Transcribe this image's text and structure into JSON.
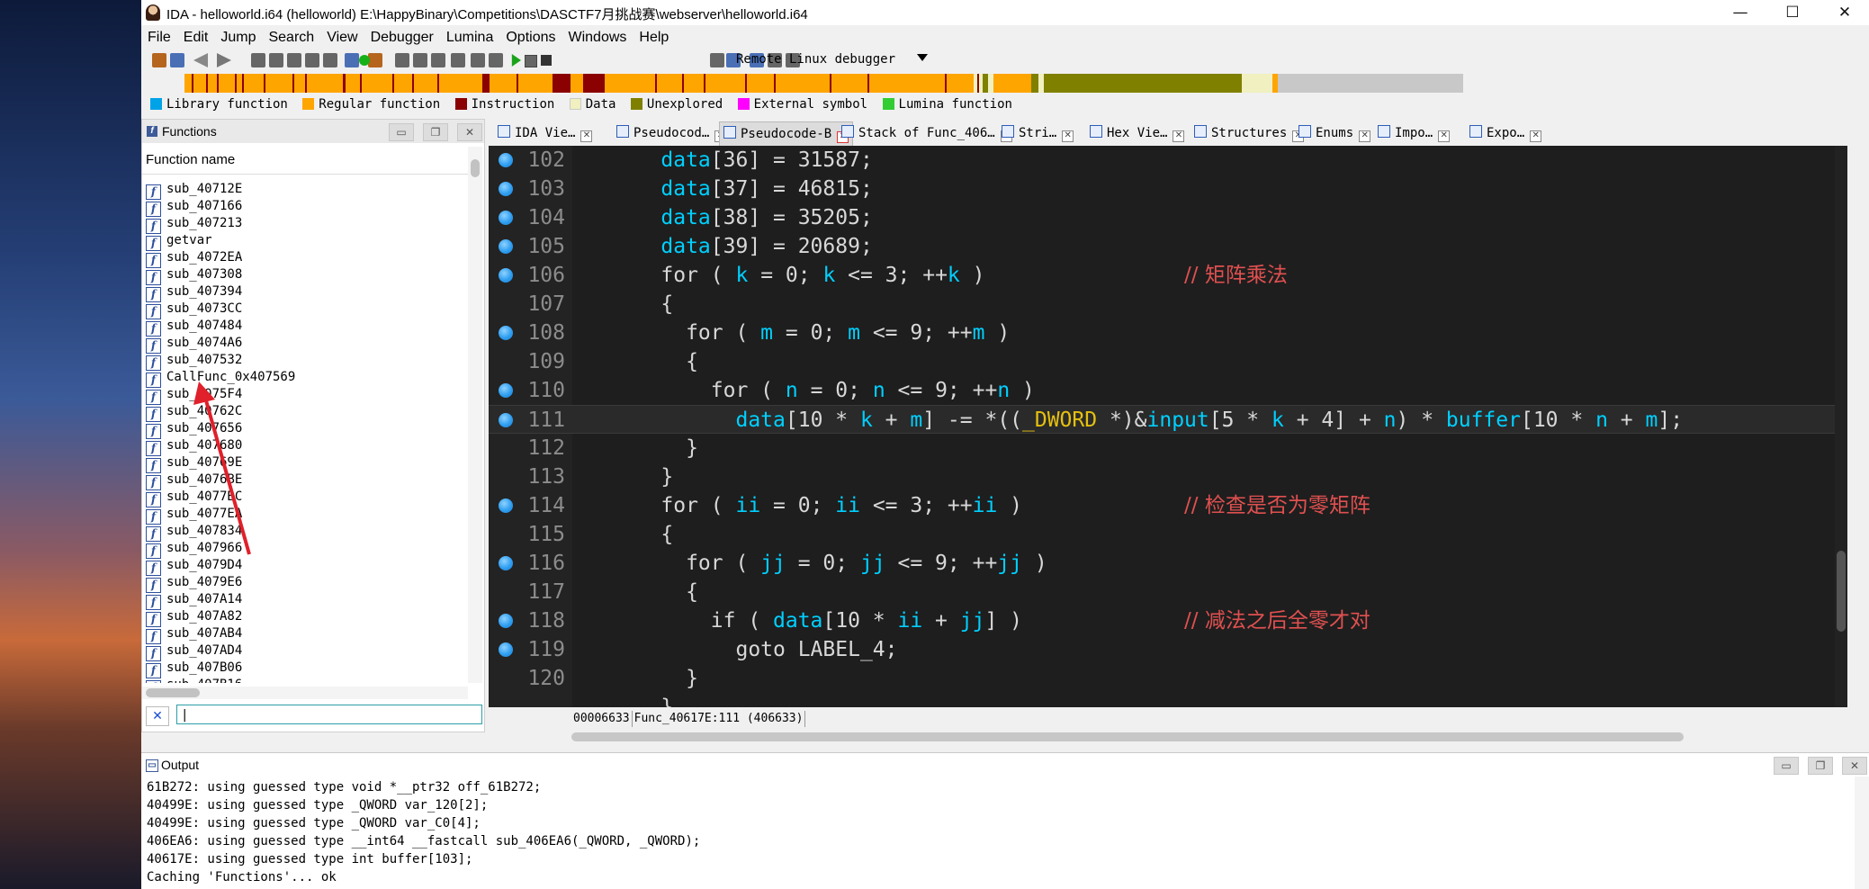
{
  "window": {
    "title": "IDA - helloworld.i64 (helloworld) E:\\HappyBinary\\Competitions\\DASCTF7月挑战赛\\webserver\\helloworld.i64",
    "controls": {
      "minimize": "—",
      "maximize": "☐",
      "close": "✕"
    }
  },
  "menu": [
    "File",
    "Edit",
    "Jump",
    "Search",
    "View",
    "Debugger",
    "Lumina",
    "Options",
    "Windows",
    "Help"
  ],
  "toolbar": {
    "debugger": "Remote Linux debugger"
  },
  "legend": [
    {
      "label": "Library function",
      "color": "#00a2e8"
    },
    {
      "label": "Regular function",
      "color": "#ffa500"
    },
    {
      "label": "Instruction",
      "color": "#8b0000"
    },
    {
      "label": "Data",
      "color": "#f0f0c0"
    },
    {
      "label": "Unexplored",
      "color": "#808000"
    },
    {
      "label": "External symbol",
      "color": "#ff00ff"
    },
    {
      "label": "Lumina function",
      "color": "#32cd32"
    }
  ],
  "functions": {
    "title": "Functions",
    "column_header": "Function name",
    "items": [
      "sub_40712E",
      "sub_407166",
      "sub_407213",
      "getvar",
      "sub_4072EA",
      "sub_407308",
      "sub_407394",
      "sub_4073CC",
      "sub_407484",
      "sub_4074A6",
      "sub_407532",
      "CallFunc_0x407569",
      "sub_4075F4",
      "sub_40762C",
      "sub_407656",
      "sub_407680",
      "sub_40769E",
      "sub_4076BE",
      "sub_4077BC",
      "sub_4077EA",
      "sub_407834",
      "sub_407966",
      "sub_4079D4",
      "sub_4079E6",
      "sub_407A14",
      "sub_407A82",
      "sub_407AB4",
      "sub_407AD4",
      "sub_407B06",
      "sub_407B16"
    ],
    "search_value": "|",
    "search_clear": "✕"
  },
  "tabs": [
    {
      "label": "IDA Vie…",
      "active": false
    },
    {
      "label": "Pseudocod…",
      "active": false
    },
    {
      "label": "Pseudocode-B",
      "active": true
    },
    {
      "label": "Stack of Func_406…",
      "active": false
    },
    {
      "label": "Stri…",
      "active": false
    },
    {
      "label": "Hex Vie…",
      "active": false
    },
    {
      "label": "Structures",
      "active": false
    },
    {
      "label": "Enums",
      "active": false
    },
    {
      "label": "Impo…",
      "active": false
    },
    {
      "label": "Expo…",
      "active": false
    }
  ],
  "code": {
    "lines": [
      {
        "n": "102",
        "bp": true
      },
      {
        "n": "103",
        "bp": true
      },
      {
        "n": "104",
        "bp": true
      },
      {
        "n": "105",
        "bp": true
      },
      {
        "n": "106",
        "bp": true
      },
      {
        "n": "107",
        "bp": false
      },
      {
        "n": "108",
        "bp": true
      },
      {
        "n": "109",
        "bp": false
      },
      {
        "n": "110",
        "bp": true
      },
      {
        "n": "111",
        "bp": true
      },
      {
        "n": "112",
        "bp": false
      },
      {
        "n": "113",
        "bp": false
      },
      {
        "n": "114",
        "bp": true
      },
      {
        "n": "115",
        "bp": false
      },
      {
        "n": "116",
        "bp": true
      },
      {
        "n": "117",
        "bp": false
      },
      {
        "n": "118",
        "bp": true
      },
      {
        "n": "119",
        "bp": true
      },
      {
        "n": "120",
        "bp": false
      }
    ],
    "comments": {
      "matmul": "// 矩阵乘法",
      "zero_check": "// 检查是否为零矩阵",
      "all_zero": "// 减法之后全零才对"
    }
  },
  "status": {
    "addr": "00006633",
    "location": "Func_40617E:111 (406633)"
  },
  "output": {
    "title": "Output",
    "lines": [
      "61B272: using guessed type void *__ptr32 off_61B272;",
      "40499E: using guessed type _QWORD var_120[2];",
      "40499E: using guessed type _QWORD var_C0[4];",
      "406EA6: using guessed type __int64 __fastcall sub_406EA6(_QWORD, _QWORD);",
      "40617E: using guessed type int buffer[103];",
      "Caching 'Functions'... ok"
    ]
  }
}
